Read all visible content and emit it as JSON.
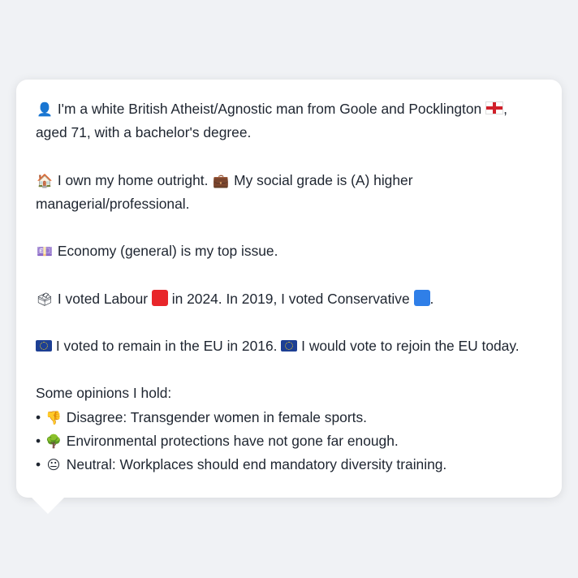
{
  "persona": {
    "intro": {
      "icon": "person-icon",
      "text1": "I'm a white British Atheist/Agnostic man from Goole and Pocklington",
      "flag": "england-flag-icon",
      "text2": ", aged 71, with a bachelor's degree."
    },
    "home": {
      "icon": "house-icon",
      "text1": "I own my home outright.",
      "icon2": "briefcase-icon",
      "text2": "My social grade is (A) higher managerial/professional."
    },
    "issue": {
      "icon": "money-icon",
      "text": "Economy (general) is my top issue."
    },
    "vote": {
      "icon": "ballot-box-icon",
      "text1": "I voted Labour",
      "labour_color": "#e8262a",
      "text2": "in 2024. In 2019, I voted Conservative",
      "conservative_color": "#2f7fe8",
      "text3": "."
    },
    "eu": {
      "icon": "eu-flag-icon",
      "text1": "I voted to remain in the EU in 2016.",
      "text2": "I would vote to rejoin the EU today."
    },
    "opinions_heading": "Some opinions I hold:",
    "opinions": [
      {
        "bullet": "•",
        "icon": "thumbs-down-icon",
        "text": "Disagree: Transgender women in female sports."
      },
      {
        "bullet": "•",
        "icon": "tree-icon",
        "text": "Environmental protections have not gone far enough."
      },
      {
        "bullet": "•",
        "icon": "neutral-face-icon",
        "text": "Neutral: Workplaces should end mandatory diversity training."
      }
    ]
  }
}
